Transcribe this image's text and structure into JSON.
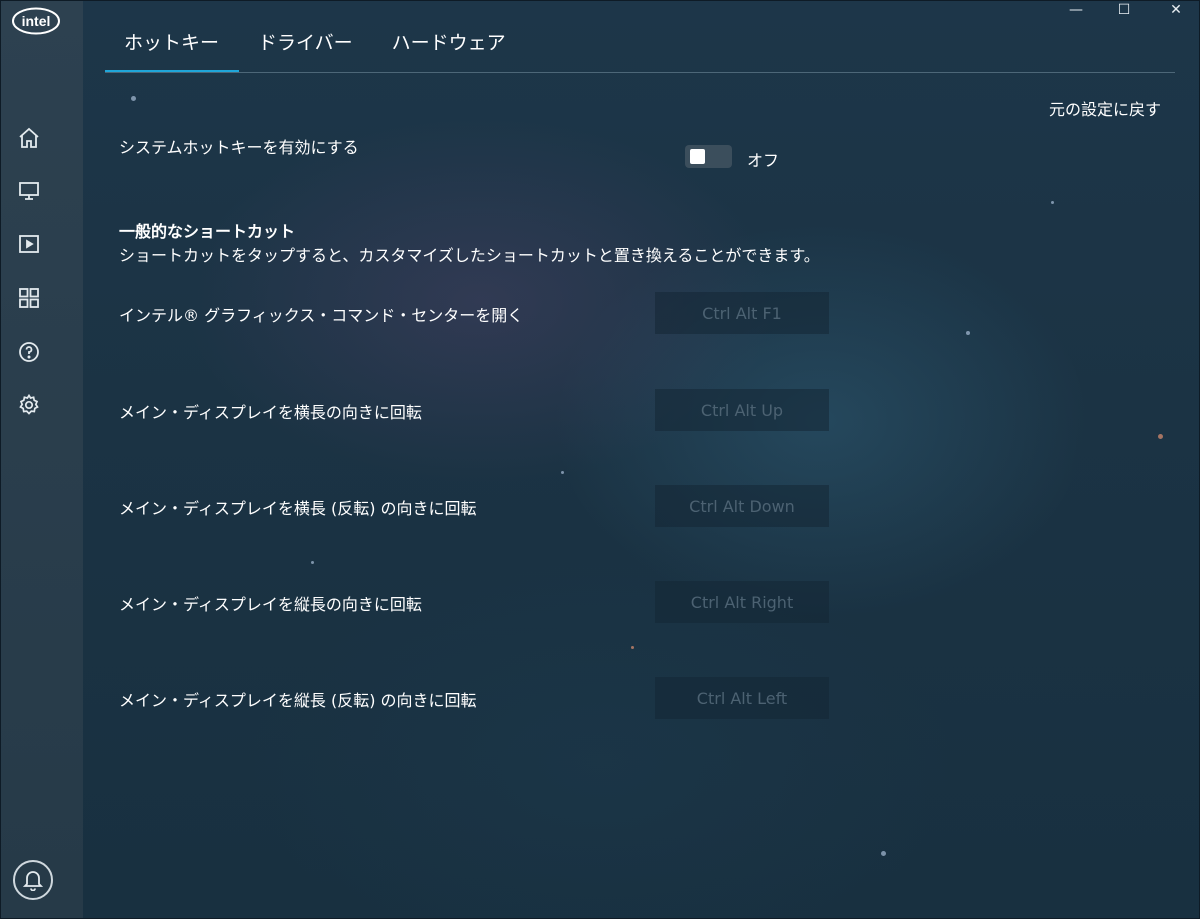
{
  "app": {
    "logo_text": "intel"
  },
  "window_controls": {
    "minimize": "—",
    "maximize": "☐",
    "close": "✕"
  },
  "sidebar": {
    "items": [
      {
        "name": "home-icon"
      },
      {
        "name": "display-icon"
      },
      {
        "name": "video-icon"
      },
      {
        "name": "apps-grid-icon"
      },
      {
        "name": "help-icon"
      },
      {
        "name": "gear-icon"
      }
    ],
    "bottom": {
      "name": "bell-icon"
    }
  },
  "tabs": [
    {
      "label": "ホットキー",
      "active": true
    },
    {
      "label": "ドライバー",
      "active": false
    },
    {
      "label": "ハードウェア",
      "active": false
    }
  ],
  "reset_label": "元の設定に戻す",
  "system_hotkeys": {
    "label": "システムホットキーを有効にする",
    "state_label": "オフ",
    "enabled": false
  },
  "general_shortcuts": {
    "title": "一般的なショートカット",
    "description": "ショートカットをタップすると、カスタマイズしたショートカットと置き換えることができます。"
  },
  "shortcuts": [
    {
      "label": "インテル® グラフィックス・コマンド・センターを開く",
      "keys": "Ctrl Alt F1"
    },
    {
      "label": "メイン・ディスプレイを横長の向きに回転",
      "keys": "Ctrl Alt Up"
    },
    {
      "label": "メイン・ディスプレイを横長 (反転) の向きに回転",
      "keys": "Ctrl Alt Down"
    },
    {
      "label": "メイン・ディスプレイを縦長の向きに回転",
      "keys": "Ctrl Alt Right"
    },
    {
      "label": "メイン・ディスプレイを縦長 (反転) の向きに回転",
      "keys": "Ctrl Alt Left"
    }
  ]
}
